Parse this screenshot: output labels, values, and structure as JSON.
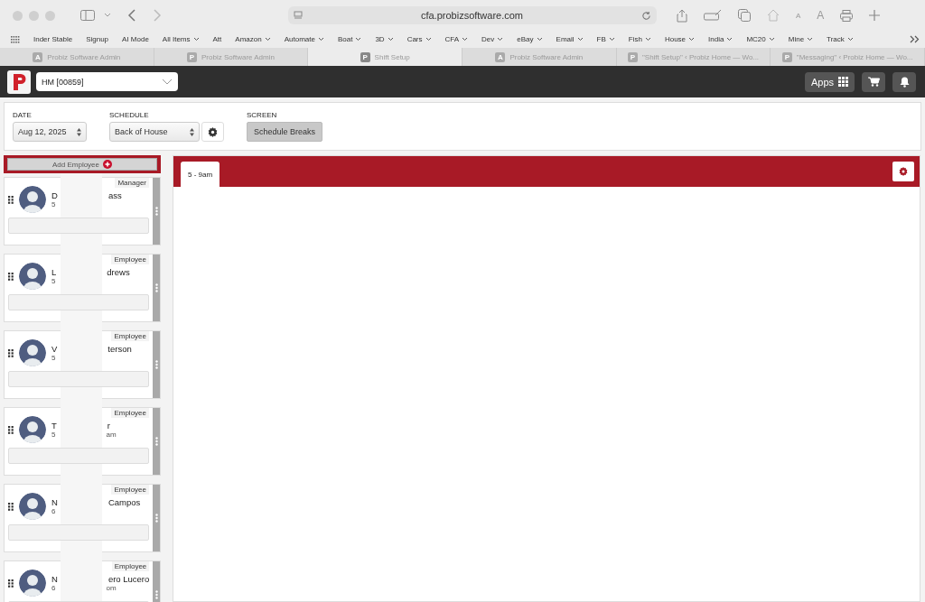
{
  "browser": {
    "url": "cfa.probizsoftware.com",
    "text_smaller": "A",
    "text_larger": "A",
    "bookmarks": [
      {
        "label": "Inder Stable",
        "menu": false
      },
      {
        "label": "Signup",
        "menu": false
      },
      {
        "label": "AI Mode",
        "menu": false
      },
      {
        "label": "All Items",
        "menu": true
      },
      {
        "label": "Att",
        "menu": false
      },
      {
        "label": "Amazon",
        "menu": true
      },
      {
        "label": "Automate",
        "menu": true
      },
      {
        "label": "Boat",
        "menu": true
      },
      {
        "label": "3D",
        "menu": true
      },
      {
        "label": "Cars",
        "menu": true
      },
      {
        "label": "CFA",
        "menu": true
      },
      {
        "label": "Dev",
        "menu": true
      },
      {
        "label": "eBay",
        "menu": true
      },
      {
        "label": "Email",
        "menu": true
      },
      {
        "label": "FB",
        "menu": true
      },
      {
        "label": "Fish",
        "menu": true
      },
      {
        "label": "House",
        "menu": true
      },
      {
        "label": "India",
        "menu": true
      },
      {
        "label": "MC20",
        "menu": true
      },
      {
        "label": "Mine",
        "menu": true
      },
      {
        "label": "Track",
        "menu": true
      }
    ],
    "tabs": [
      {
        "title": "Probiz Software Admin",
        "favicon": "A",
        "selected": false
      },
      {
        "title": "Probiz Software Admin",
        "favicon": "P",
        "selected": false
      },
      {
        "title": "Shift Setup",
        "favicon": "P",
        "selected": true
      },
      {
        "title": "Probiz Software Admin",
        "favicon": "A",
        "selected": false
      },
      {
        "title": "\"Shift Setup\" ‹ Probiz Home — Wo...",
        "favicon": "P",
        "selected": false
      },
      {
        "title": "\"Messaging\" ‹ Probiz Home — Wo...",
        "favicon": "P",
        "selected": false
      }
    ]
  },
  "header": {
    "location": "HM [00859]",
    "apps_label": "Apps"
  },
  "filters": {
    "date_label": "DATE",
    "date": "Aug 12, 2025",
    "schedule_label": "SCHEDULE",
    "schedule": "Back of House",
    "screen_label": "SCREEN",
    "screen_button": "Schedule Breaks"
  },
  "add_employee": "Add Employee",
  "employees": [
    {
      "role": "Manager",
      "name_start": "D",
      "name_end": "ass",
      "time_start": "5"
    },
    {
      "role": "Employee",
      "name_start": "L",
      "name_end": "drews",
      "time_start": "5"
    },
    {
      "role": "Employee",
      "name_start": "V",
      "name_end": "terson",
      "time_start": "5"
    },
    {
      "role": "Employee",
      "name_start": "T",
      "name_end": "r",
      "time_start": "5",
      "time_end": "am"
    },
    {
      "role": "Employee",
      "name_start": "N",
      "name_end": "Campos",
      "time_start": "6"
    },
    {
      "role": "Employee",
      "name_start": "N",
      "name_end": "ero Lucero",
      "time_start": "6",
      "time_end": "om"
    }
  ],
  "shift_tabs": [
    {
      "label": "5 - 9am",
      "selected": true
    }
  ]
}
